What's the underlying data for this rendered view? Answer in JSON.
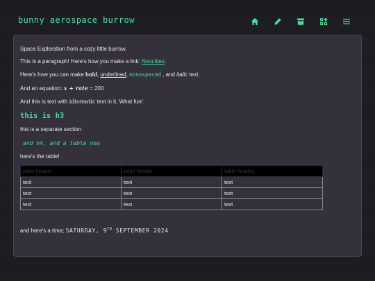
{
  "header": {
    "title": "bunny aerospace burrow",
    "nav": [
      {
        "name": "home-icon"
      },
      {
        "name": "pencil-icon"
      },
      {
        "name": "archive-icon"
      },
      {
        "name": "widgets-icon"
      },
      {
        "name": "menu-icon"
      }
    ]
  },
  "content": {
    "intro": "Space Exploration from a cozy little burrow.",
    "para_text": "This is a paragraph! Here's how you make a link: ",
    "link_text": "Neocities",
    "para_end": ".",
    "fmt_prefix": "Here's how you can make ",
    "bold": "bold",
    "comma1": ", ",
    "underlined": "underlined",
    "comma2": ", ",
    "monospaced": "monospaced",
    "and_italic_prefix": " , and ",
    "italic": "italic",
    "fmt_suffix": " text.",
    "eq_prefix": "And an equation: ",
    "eq_expr": "x + rate",
    "eq_suffix": " = 200",
    "idiom_prefix": "And this is text with ",
    "idiom_word": "idiomatic",
    "idiom_suffix": " text in it. What fun!",
    "h3": "this is h3",
    "section": "this is a separate section",
    "h4": "and h4, and a table now",
    "table_intro": "here's the table!",
    "time_prefix": "and here's a time; ",
    "time_a": "SATURDAY, 9",
    "time_sup": "TH",
    "time_b": " SEPTEMBER 2024"
  },
  "table": {
    "headers": [
      "table header",
      "table header",
      "table header"
    ],
    "rows": [
      [
        "text",
        "text",
        "text"
      ],
      [
        "text",
        "text",
        "text"
      ],
      [
        "text",
        "text",
        "text"
      ]
    ]
  },
  "colors": {
    "accent": "#3ee29a",
    "background": "#1c1b21",
    "panel": "#34313d"
  }
}
